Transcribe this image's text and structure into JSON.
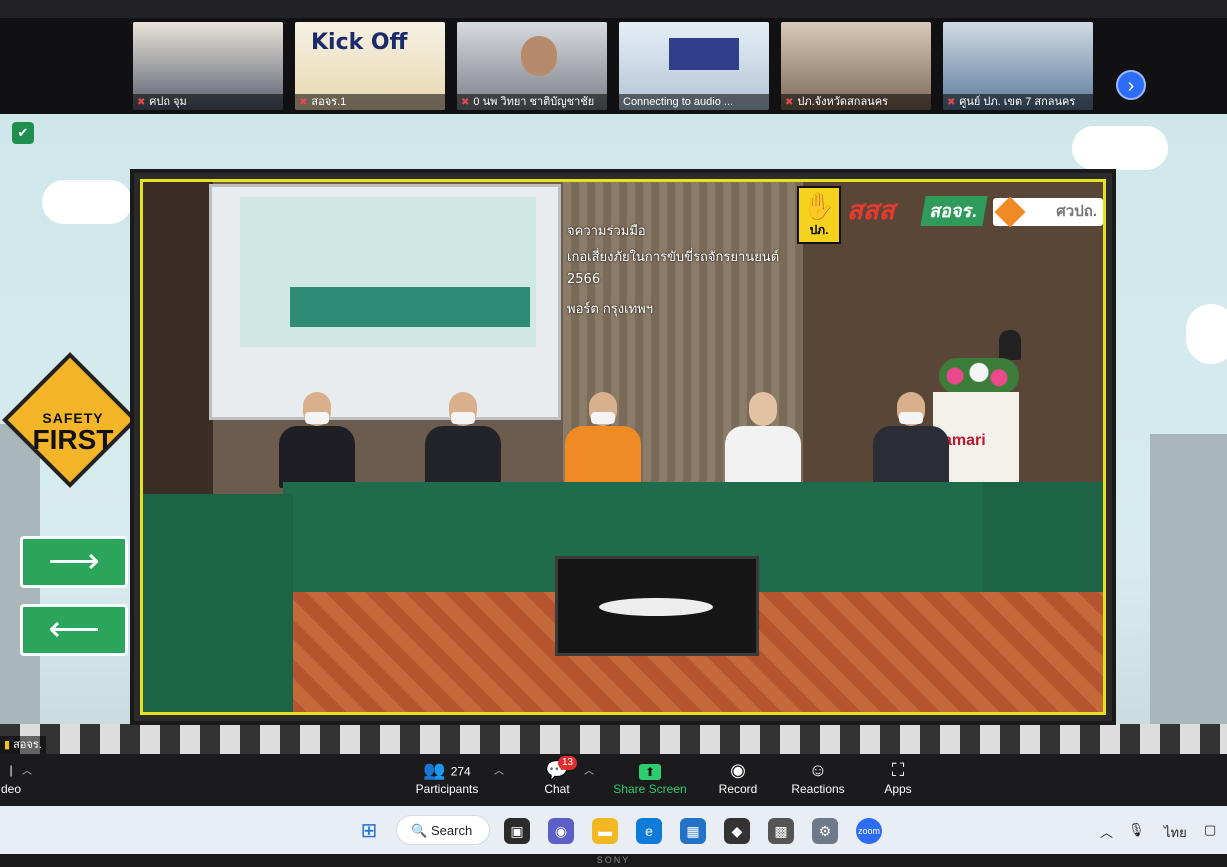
{
  "gallery": {
    "tiles": [
      {
        "name": "ศปถ จุม"
      },
      {
        "name": "สอจร.1",
        "title": "Kick Off"
      },
      {
        "name": "0 นพ วิทยา ชาติบัญชาชัย"
      },
      {
        "name": "Connecting to audio ..."
      },
      {
        "name": "ปภ.จังหวัดสกลนคร"
      },
      {
        "name": "ศูนย์ ปภ. เขต 7 สกลนคร"
      }
    ]
  },
  "share": {
    "banner_lines": [
      "จความร่วมมือ",
      "เกอเสี่ยงภัยในการขับขี่รถจักรยานยนต์",
      "2566",
      "พอร์ต กรุงเทพฯ"
    ],
    "logos": {
      "pp": "ปภ.",
      "sss": "สสส",
      "ojr": "สอจร.",
      "kwpt": "ศวปถ."
    },
    "podium_brand": "amari",
    "sign_top": "SAFETY",
    "sign_main": "FIRST"
  },
  "active_speaker_label": "สอจร.",
  "controls": {
    "video_label": "deo",
    "participants_count": "274",
    "participants_label": "Participants",
    "chat_label": "Chat",
    "chat_badge": "13",
    "share_label": "Share Screen",
    "record_label": "Record",
    "reactions_label": "Reactions",
    "apps_label": "Apps"
  },
  "taskbar": {
    "search_label": "Search",
    "language": "ไทย"
  },
  "bezel_brand": "SONY",
  "colors": {
    "accent_green": "#2ecc71",
    "badge_red": "#e02e2e",
    "zoom_blue": "#2d6cf6"
  }
}
